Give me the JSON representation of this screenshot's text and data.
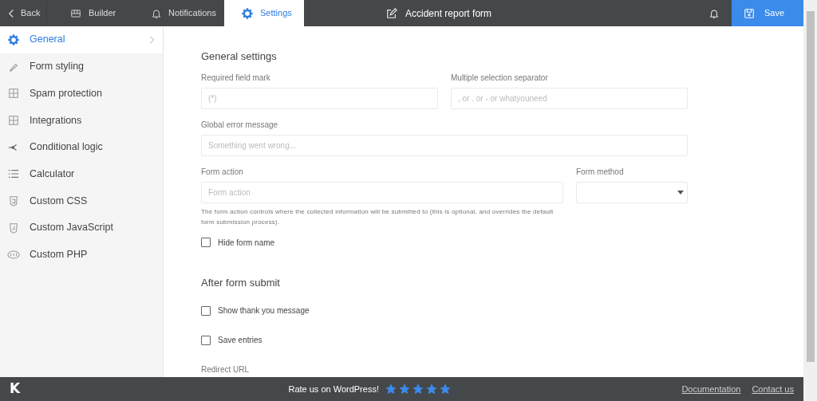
{
  "topbar": {
    "back": "Back",
    "tabs": [
      {
        "label": "Builder",
        "selected": false
      },
      {
        "label": "Notifications",
        "selected": false
      },
      {
        "label": "Settings",
        "selected": true
      }
    ],
    "title": "Accident report form",
    "save": "Save"
  },
  "sidebar": {
    "items": [
      {
        "label": "General",
        "selected": true
      },
      {
        "label": "Form styling",
        "selected": false
      },
      {
        "label": "Spam protection",
        "selected": false
      },
      {
        "label": "Integrations",
        "selected": false
      },
      {
        "label": "Conditional logic",
        "selected": false
      },
      {
        "label": "Calculator",
        "selected": false
      },
      {
        "label": "Custom CSS",
        "selected": false
      },
      {
        "label": "Custom JavaScript",
        "selected": false
      },
      {
        "label": "Custom PHP",
        "selected": false
      }
    ]
  },
  "general": {
    "heading": "General settings",
    "required_mark": {
      "label": "Required field mark",
      "placeholder": "(*)"
    },
    "separator": {
      "label": "Multiple selection separator",
      "placeholder": ", or . or - or whatyouneed"
    },
    "error_message": {
      "label": "Global error message",
      "placeholder": "Something went wrong..."
    },
    "form_action": {
      "label": "Form action",
      "placeholder": "Form action",
      "help": "The form action controls where the collected information will be submitted to (this is optional, and overrides the default form submission process)."
    },
    "form_method": {
      "label": "Form method"
    },
    "hide_name": {
      "label": "Hide form name",
      "checked": false
    }
  },
  "after_submit": {
    "heading": "After form submit",
    "options": [
      {
        "label": "Show thank you message",
        "checked": false
      },
      {
        "label": "Save entries",
        "checked": false
      }
    ],
    "redirect_label": "Redirect URL"
  },
  "footer": {
    "logo": "K",
    "rate": "Rate us on WordPress!",
    "stars": 5,
    "links": [
      "Documentation",
      "Contact us"
    ]
  }
}
